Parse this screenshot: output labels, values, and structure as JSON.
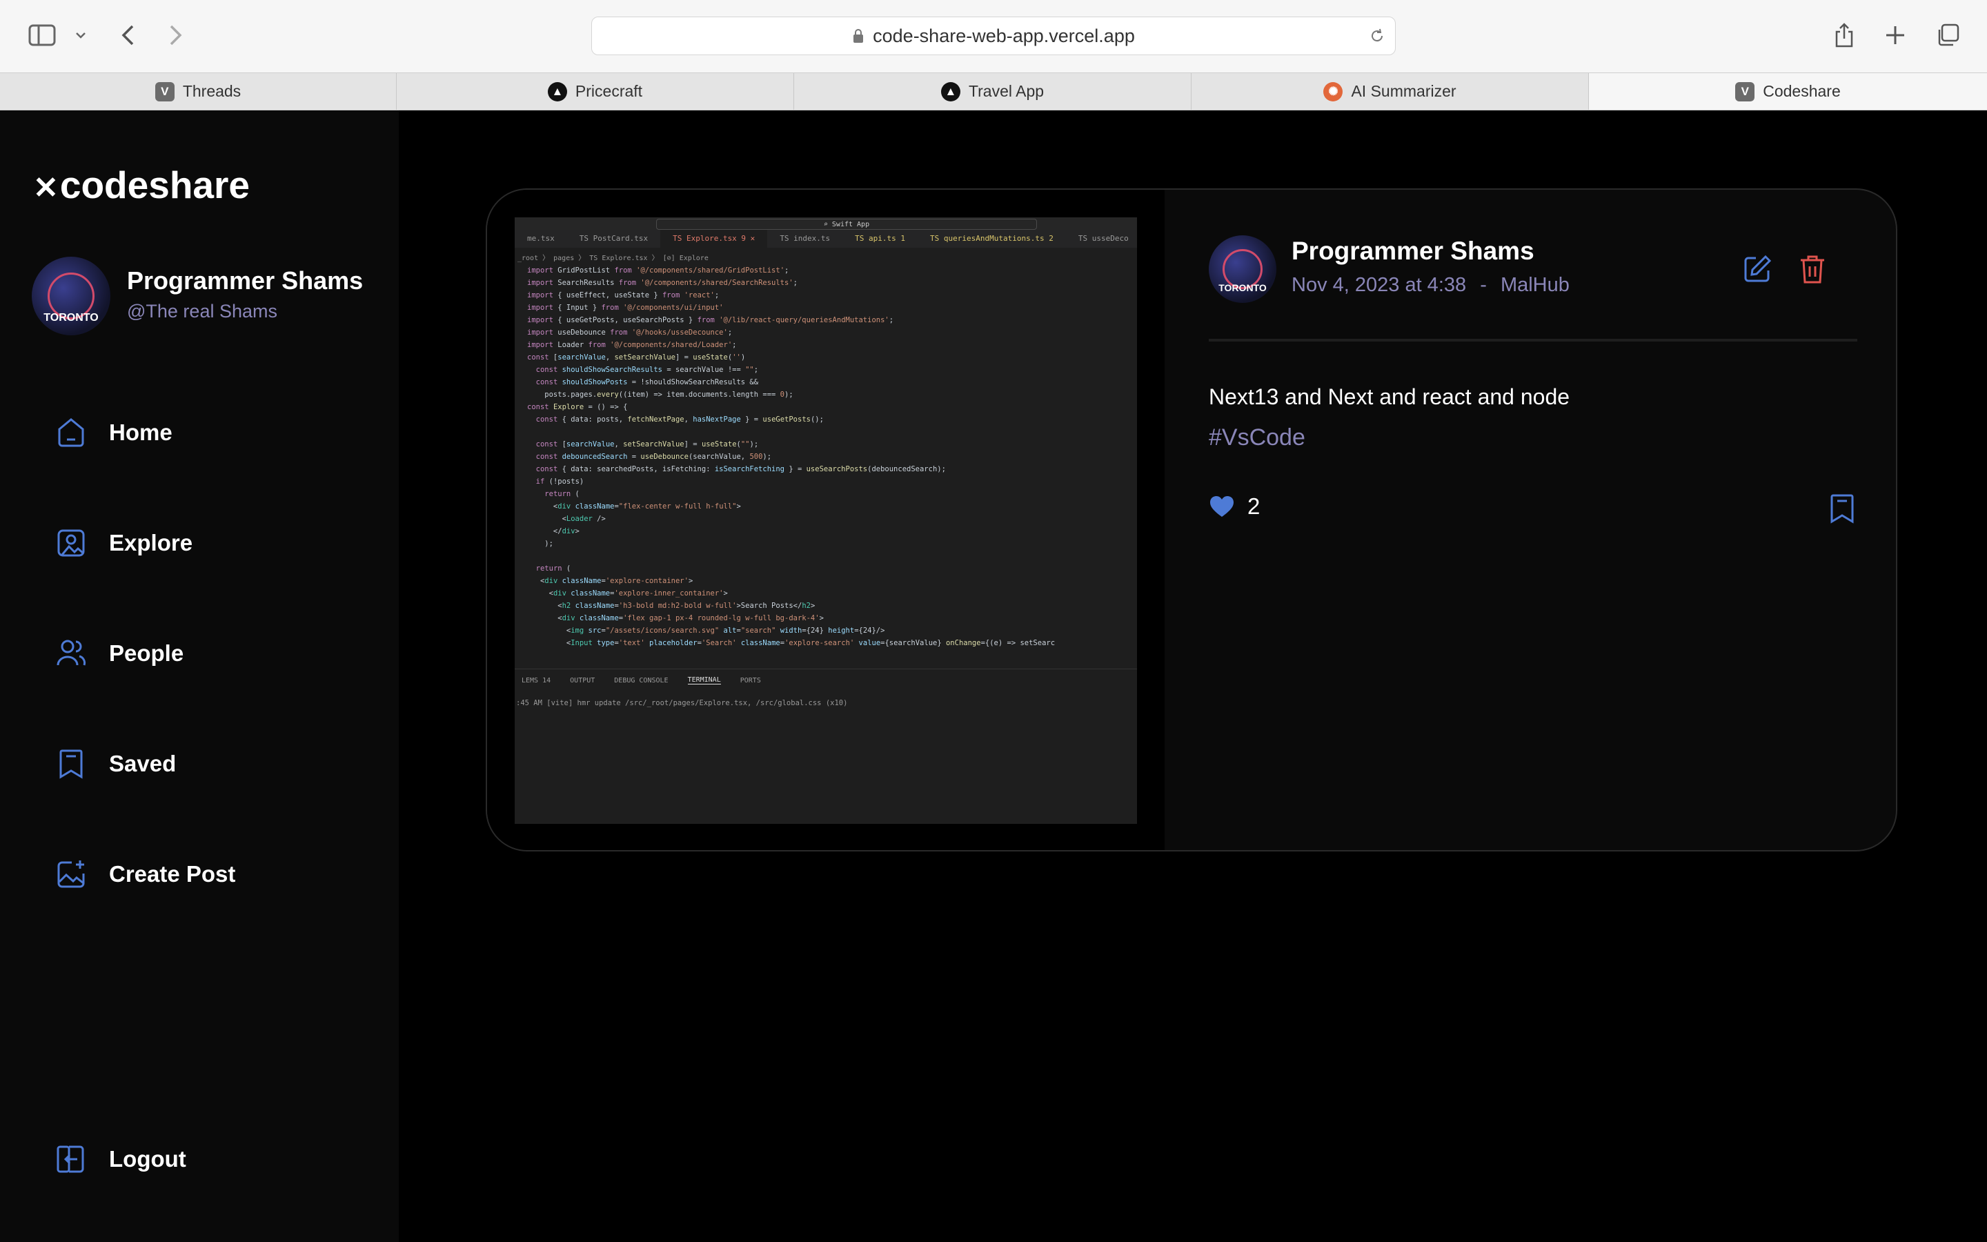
{
  "browser": {
    "url": "code-share-web-app.vercel.app",
    "tabs": [
      {
        "label": "Threads",
        "icon": "V"
      },
      {
        "label": "Pricecraft",
        "icon": "triangle"
      },
      {
        "label": "Travel App",
        "icon": "triangle"
      },
      {
        "label": "AI Summarizer",
        "icon": "ai"
      },
      {
        "label": "Codeshare",
        "icon": "V"
      }
    ]
  },
  "sidebar": {
    "logo": "codeshare",
    "profile": {
      "name": "Programmer Shams",
      "handle": "@The real Shams",
      "avatar_text": "TORONTO"
    },
    "nav": [
      {
        "label": "Home",
        "icon": "home-icon"
      },
      {
        "label": "Explore",
        "icon": "gallery-icon"
      },
      {
        "label": "People",
        "icon": "people-icon"
      },
      {
        "label": "Saved",
        "icon": "bookmark-icon"
      },
      {
        "label": "Create Post",
        "icon": "image-add-icon"
      }
    ],
    "logout": "Logout",
    "accent": "#4e7bd6"
  },
  "post": {
    "author": "Programmer Shams",
    "date": "Nov 4, 2023 at 4:38",
    "separator": "-",
    "location": "MalHub",
    "caption": "Next13 and Next and react and node",
    "tags": "#VsCode",
    "likes": "2",
    "colors": {
      "edit": "#4e7bd6",
      "delete": "#e0544e",
      "like": "#4e7bd6"
    }
  },
  "screenshot": {
    "search": "⌕ Swift App",
    "tabs": [
      "me.tsx",
      "TS PostCard.tsx",
      "TS Explore.tsx 9 ✕",
      "TS index.ts",
      "TS api.ts   1",
      "TS queriesAndMutations.ts 2",
      "TS usseDeco"
    ],
    "breadcrumb": "_root 〉 pages 〉 TS Explore.tsx 〉 [⊘] Explore",
    "panel_tabs": [
      "LEMS 14",
      "OUTPUT",
      "DEBUG CONSOLE",
      "TERMINAL",
      "PORTS"
    ],
    "terminal": ":45 AM [vite] hmr update /src/_root/pages/Explore.tsx, /src/global.css (x10)"
  }
}
